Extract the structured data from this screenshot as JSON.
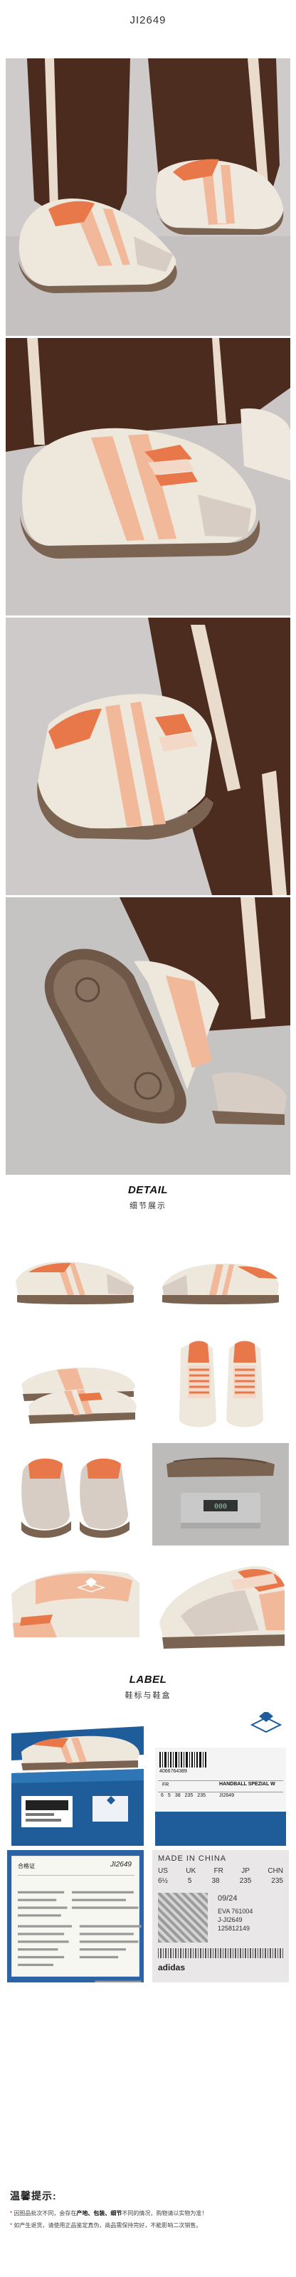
{
  "header": {
    "sku": "JI2649"
  },
  "detail": {
    "title": "DETAIL",
    "subtitle": "细节展示"
  },
  "label": {
    "title": "LABEL",
    "subtitle": "鞋标与鞋盒"
  },
  "box_label": {
    "barcode_number": "4066764389",
    "size_header": "FR",
    "sizes": [
      "6",
      "5",
      "38",
      "235",
      "235"
    ],
    "model": "HANDBALL SPEZIAL W",
    "code": "JI2649"
  },
  "certificate": {
    "heading": "合格证",
    "code": "JI2649"
  },
  "tag": {
    "made_in": "MADE IN CHINA",
    "size_headers": [
      "US",
      "UK",
      "FR",
      "JP",
      "CHN"
    ],
    "size_values": [
      "6½",
      "5",
      "38",
      "235",
      "235"
    ],
    "date": "09/24",
    "codes": [
      "EVA 761004",
      "J-JI2649",
      "125812149"
    ],
    "brand": "adidas"
  },
  "notice": {
    "title": "温馨提示:",
    "lines": [
      {
        "star": "*",
        "pre": "因图品批次不同，会存在",
        "bold": "产地、包装、细节",
        "post": "不同的情况，购物请以实物为准！"
      },
      {
        "star": "*",
        "pre": "如产生退货，请使用正品鉴定真伪，商品需保持完好，不能影响二次销售。",
        "bold": "",
        "post": ""
      }
    ]
  },
  "colors": {
    "cream": "#efe9df",
    "peach": "#f1b99a",
    "orange": "#e8784a",
    "gum": "#7a6350",
    "suede": "#d7cdc4",
    "pants": "#4a2b1e",
    "stripe": "#e8d9c8",
    "box_blue": "#1f5d9a"
  }
}
